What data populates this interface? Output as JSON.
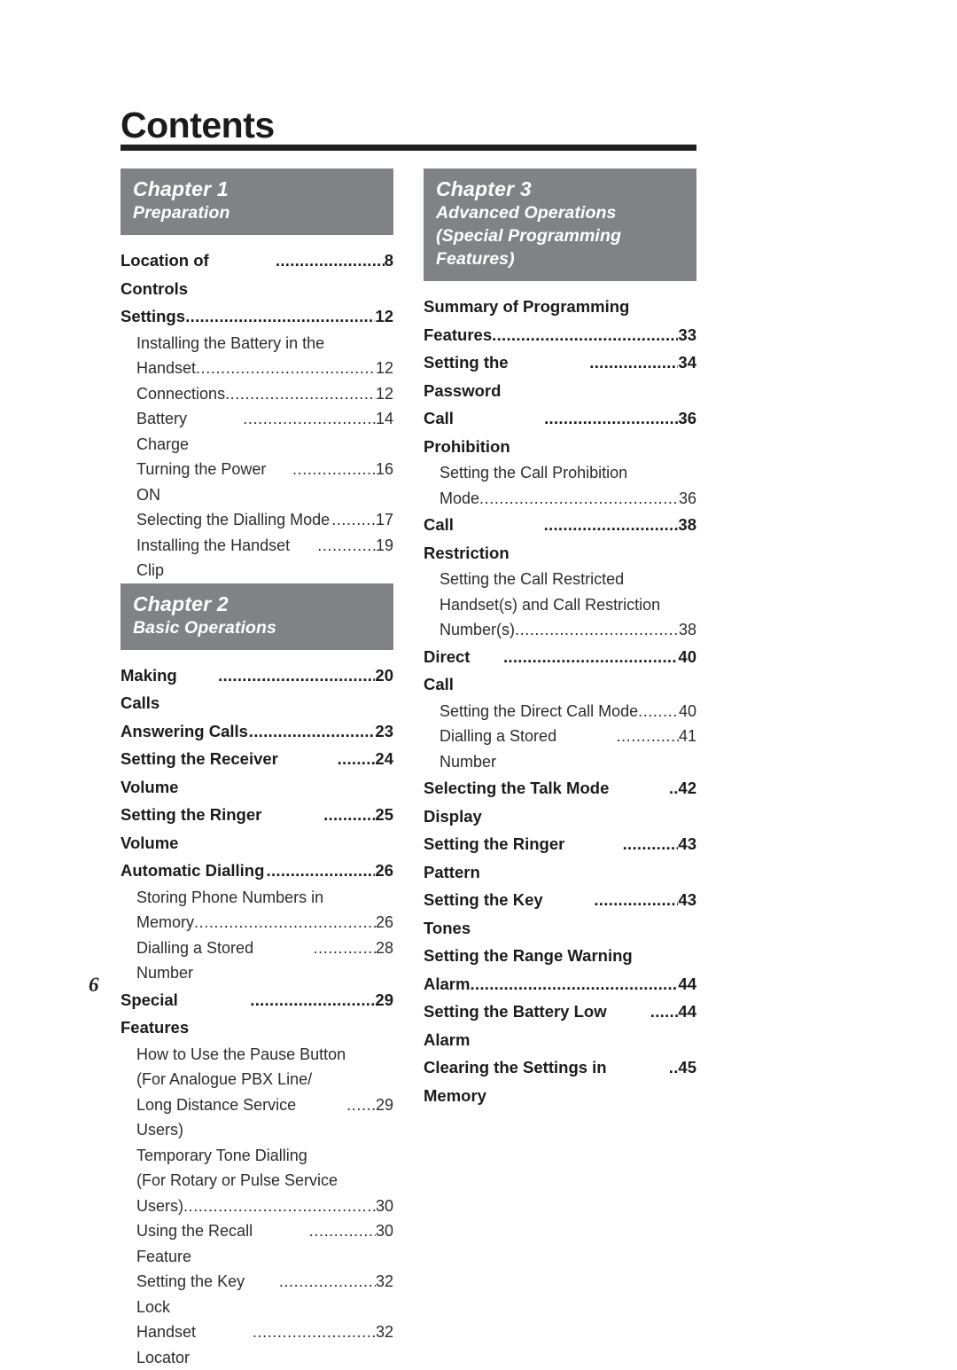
{
  "page": {
    "title": "Contents",
    "folio": "6"
  },
  "columns": [
    {
      "name": "left-column",
      "blocks": [
        {
          "type": "chapter",
          "number": "Chapter  1",
          "subtitle": "Preparation"
        },
        {
          "type": "entries",
          "items": [
            {
              "level": 1,
              "label": "Location of Controls ",
              "leader": "........................",
              "page": "8"
            },
            {
              "level": 1,
              "label": "Settings ",
              "leader": "..........................................",
              "page": "12"
            },
            {
              "level": 2,
              "label": "Installing the Battery in the",
              "leader": "",
              "page": ""
            },
            {
              "level": 2,
              "label": "Handset ",
              "leader": ".......................................",
              "page": "12"
            },
            {
              "level": 2,
              "label": "Connections ",
              "leader": "................................",
              "page": "12"
            },
            {
              "level": 2,
              "label": "Battery Charge ",
              "leader": "............................",
              "page": "14"
            },
            {
              "level": 2,
              "label": "Turning the Power ON",
              "leader": ".................",
              "page": "16"
            },
            {
              "level": 2,
              "label": "Selecting the Dialling Mode ",
              "leader": ".........",
              "page": "17"
            },
            {
              "level": 2,
              "label": "Installing the Handset Clip",
              "leader": "............",
              "page": "19"
            }
          ]
        },
        {
          "type": "chapter",
          "number": "Chapter  2",
          "subtitle": "Basic Operations"
        },
        {
          "type": "entries",
          "items": [
            {
              "level": 1,
              "label": "Making Calls ",
              "leader": "...................................",
              "page": "20"
            },
            {
              "level": 1,
              "label": "Answering Calls ",
              "leader": "...........................",
              "page": "23"
            },
            {
              "level": 1,
              "label": "Setting the Receiver Volume",
              "leader": "........",
              "page": "24"
            },
            {
              "level": 1,
              "label": "Setting the Ringer Volume ",
              "leader": "...........",
              "page": "25"
            },
            {
              "level": 1,
              "label": "Automatic Dialling ",
              "leader": ".......................",
              "page": "26"
            },
            {
              "level": 2,
              "label": "Storing Phone Numbers in",
              "leader": "",
              "page": ""
            },
            {
              "level": 2,
              "label": "Memory",
              "leader": "........................................",
              "page": "26"
            },
            {
              "level": 2,
              "label": "Dialling a Stored Number ",
              "leader": ".............",
              "page": "28"
            },
            {
              "level": 1,
              "label": "Special Features ",
              "leader": "...........................",
              "page": "29"
            },
            {
              "level": 2,
              "label": "How to Use the Pause Button",
              "leader": "",
              "page": ""
            },
            {
              "level": 2,
              "label": "(For Analogue PBX Line/",
              "leader": "",
              "page": ""
            },
            {
              "level": 2,
              "label": "Long Distance Service Users) ",
              "leader": "......",
              "page": "29"
            },
            {
              "level": 2,
              "label": "Temporary Tone Dialling",
              "leader": "",
              "page": ""
            },
            {
              "level": 2,
              "label": "(For Rotary or Pulse Service",
              "leader": "",
              "page": ""
            },
            {
              "level": 2,
              "label": "Users)",
              "leader": ".........................................",
              "page": "30"
            },
            {
              "level": 2,
              "label": "Using the Recall Feature ",
              "leader": "..............",
              "page": "30"
            },
            {
              "level": 2,
              "label": "Setting the Key Lock",
              "leader": "....................",
              "page": "32"
            },
            {
              "level": 2,
              "label": "Handset Locator ",
              "leader": "..........................",
              "page": "32"
            }
          ]
        }
      ]
    },
    {
      "name": "right-column",
      "blocks": [
        {
          "type": "chapter",
          "number": "Chapter  3",
          "subtitle": "Advanced Operations (Special Programming Features)"
        },
        {
          "type": "entries",
          "items": [
            {
              "level": 1,
              "label": "Summary of Programming",
              "leader": "",
              "page": ""
            },
            {
              "level": 1,
              "label": "Features",
              "leader": "..........................................",
              "page": "33"
            },
            {
              "level": 1,
              "label": "Setting the Password ",
              "leader": "...................",
              "page": "34"
            },
            {
              "level": 1,
              "label": "Call Prohibition ",
              "leader": ".............................",
              "page": "36"
            },
            {
              "level": 2,
              "label": "Setting the Call Prohibition",
              "leader": "",
              "page": ""
            },
            {
              "level": 2,
              "label": "Mode",
              "leader": "..............................................",
              "page": "36"
            },
            {
              "level": 1,
              "label": "Call Restriction ",
              "leader": ".............................",
              "page": "38"
            },
            {
              "level": 2,
              "label": "Setting the Call Restricted",
              "leader": "",
              "page": ""
            },
            {
              "level": 2,
              "label": "Handset(s) and Call Restriction",
              "leader": "",
              "page": ""
            },
            {
              "level": 2,
              "label": "Number(s)",
              "leader": "....................................",
              "page": "38"
            },
            {
              "level": 1,
              "label": "Direct Call ",
              "leader": ".......................................",
              "page": "40"
            },
            {
              "level": 2,
              "label": "Setting the Direct Call Mode",
              "leader": "........",
              "page": "40"
            },
            {
              "level": 2,
              "label": "Dialling a Stored Number ",
              "leader": ".............",
              "page": "41"
            },
            {
              "level": 1,
              "label": "Selecting the Talk Mode Display ",
              "leader": "..",
              "page": "42"
            },
            {
              "level": 1,
              "label": "Setting the Ringer Pattern ",
              "leader": "............",
              "page": "43"
            },
            {
              "level": 1,
              "label": "Setting the Key Tones ",
              "leader": "..................",
              "page": "43"
            },
            {
              "level": 1,
              "label": "Setting the Range Warning",
              "leader": "",
              "page": ""
            },
            {
              "level": 1,
              "label": "Alarm",
              "leader": "...............................................",
              "page": "44"
            },
            {
              "level": 1,
              "label": "Setting the Battery Low Alarm",
              "leader": "......",
              "page": "44"
            },
            {
              "level": 1,
              "label": "Clearing the Settings in Memory",
              "leader": "..",
              "page": "45"
            }
          ]
        }
      ]
    }
  ],
  "colors": {
    "banner_gray": "#808286",
    "rule_black": "#212121",
    "text": "#1b1b1b"
  }
}
